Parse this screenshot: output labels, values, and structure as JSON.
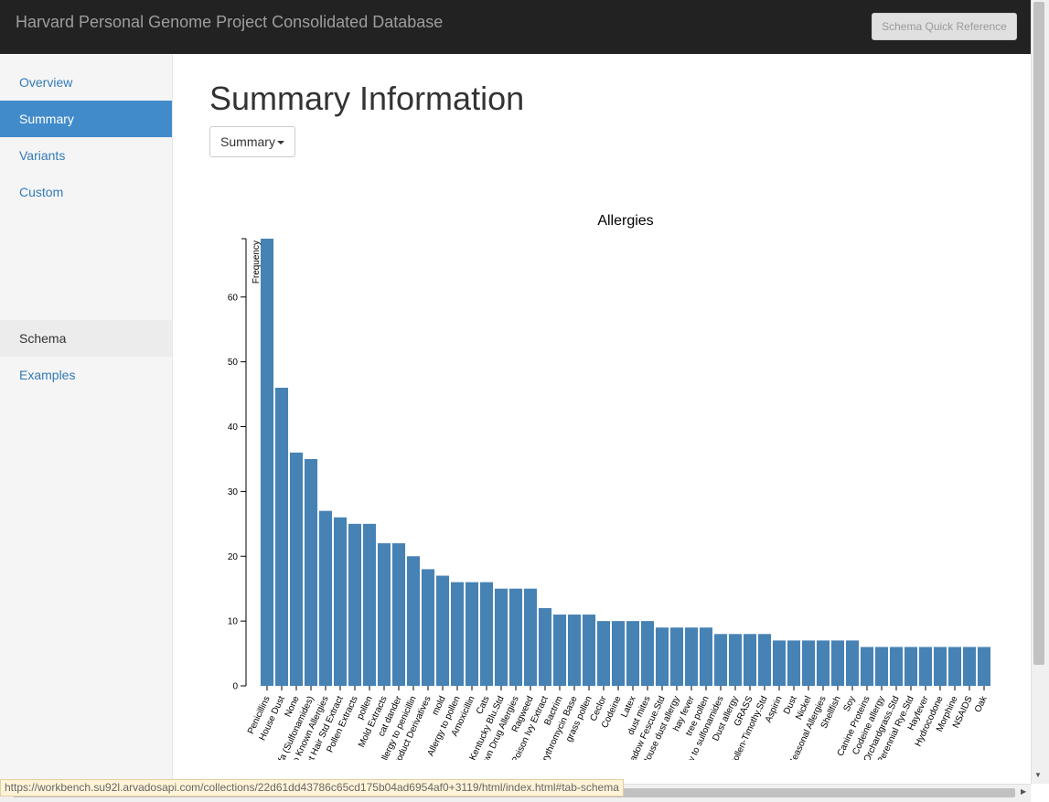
{
  "navbar": {
    "brand": "Harvard Personal Genome Project Consolidated Database",
    "schema_button": "Schema Quick Reference"
  },
  "sidebar": {
    "items": [
      {
        "label": "Overview"
      },
      {
        "label": "Summary"
      },
      {
        "label": "Variants"
      },
      {
        "label": "Custom"
      },
      {
        "label": "Schema"
      },
      {
        "label": "Examples"
      }
    ]
  },
  "main": {
    "title": "Summary Information",
    "dropdown_label": "Summary"
  },
  "statusbar": {
    "url": "https://workbench.su92l.arvadosapi.com/collections/22d61dd43786c65cd175b04ad6954af0+3119/html/index.html#tab-schema"
  },
  "colors": {
    "bar": "#4682b4",
    "navbar": "#222222",
    "active": "#428bca",
    "link": "#337ab7"
  },
  "chart_data": {
    "type": "bar",
    "title": "Allergies",
    "ylabel": "Frequency",
    "xlabel": "",
    "ylim": [
      0,
      69
    ],
    "yticks": [
      0,
      10,
      20,
      30,
      40,
      50,
      60
    ],
    "categories": [
      "Penicillins",
      "House Dust",
      "None",
      "Sulfa (Sulfonamides)",
      "No Known Allergies",
      "Cat Hair Std Extract",
      "Pollen Extracts",
      "pollen",
      "Mold Extracts",
      "cat dander",
      "Allergy to penicillin",
      "Cat/Feline Product Derivatives",
      "mold",
      "Allergy to pollen",
      "Amoxicillin",
      "Cats",
      "Grass Pollen-Kentucky Blu.Std",
      "No Known Drug Allergies",
      "Ragweed",
      "Poison Ivy Extract",
      "Bactrim",
      "Erythromycin Base",
      "grass pollen",
      "Ceclor",
      "Codeine",
      "Latex",
      "dust mites",
      "Grass Poll-Meadow Fescue.Std",
      "House dust allergy",
      "hay fever",
      "tree pollen",
      "Allergy to sulfonamides",
      "Dust allergy",
      "GRASS",
      "Grass Pollen-Timothy.Std",
      "Aspirin",
      "Dust",
      "Nickel",
      "Seasonal Allergies",
      "Shellfish",
      "Soy",
      "Canine Proteins",
      "Codeine allergy",
      "Grass Poll-Orchardgrass.Std",
      "Grass Poll-Perennial Rye.Std",
      "Hayfever",
      "Hydrocodone",
      "Morphine",
      "NSAIDS",
      "Oak"
    ],
    "values": [
      69,
      46,
      36,
      35,
      27,
      26,
      25,
      25,
      22,
      22,
      20,
      18,
      17,
      16,
      16,
      16,
      15,
      15,
      15,
      12,
      11,
      11,
      11,
      10,
      10,
      10,
      10,
      9,
      9,
      9,
      9,
      8,
      8,
      8,
      8,
      7,
      7,
      7,
      7,
      7,
      7,
      6,
      6,
      6,
      6,
      6,
      6,
      6,
      6,
      6
    ],
    "grid": false,
    "legend": "none"
  }
}
